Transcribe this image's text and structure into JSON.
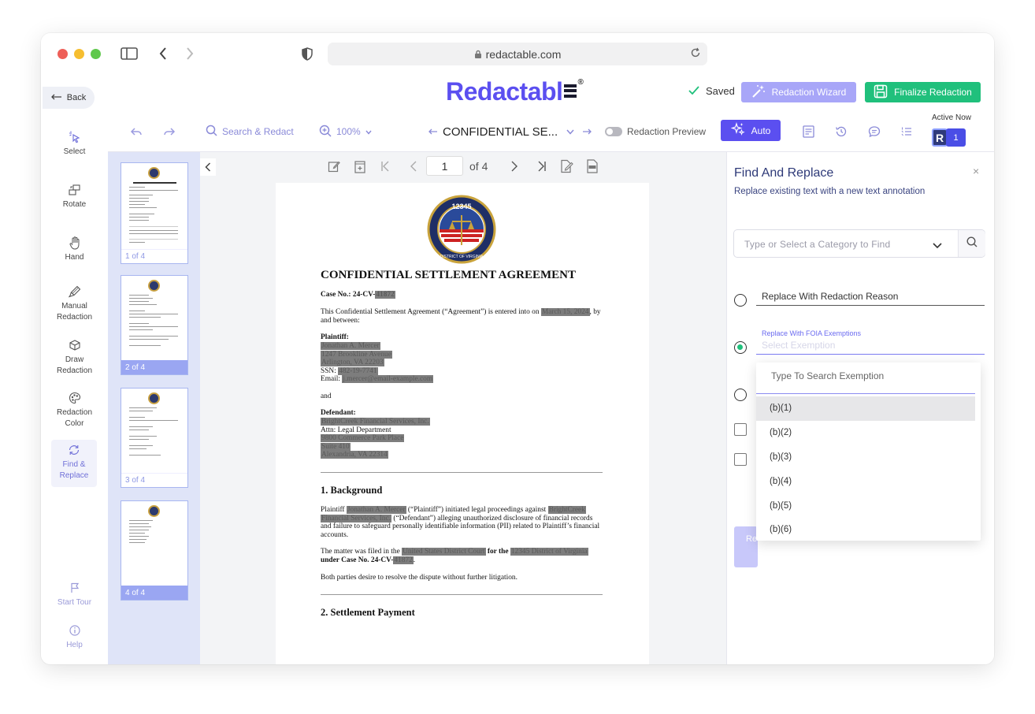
{
  "browser": {
    "url": "redactable.com"
  },
  "header": {
    "back_label": "Back",
    "logo_text": "Redactabl",
    "logo_reg": "®",
    "saved_label": "Saved",
    "wizard_label": "Redaction Wizard",
    "finalize_label": "Finalize Redaction"
  },
  "toolbar": {
    "search_label": "Search & Redact",
    "zoom_label": "100%",
    "doc_title": "CONFIDENTIAL SE...",
    "preview_label": "Redaction Preview",
    "auto_label": "Auto",
    "active_now_label": "Active Now",
    "avatar_initial": "R",
    "active_count": "1"
  },
  "sidebar": {
    "items": [
      {
        "label": "Select"
      },
      {
        "label": "Rotate"
      },
      {
        "label": "Hand"
      },
      {
        "label": "Manual Redaction"
      },
      {
        "label": "Draw Redaction"
      },
      {
        "label": "Redaction Color"
      },
      {
        "label": "Find & Replace"
      }
    ],
    "start_tour": "Start Tour",
    "help": "Help"
  },
  "thumbnails": [
    {
      "label": "1 of 4"
    },
    {
      "label": "2 of 4"
    },
    {
      "label": "3 of 4"
    },
    {
      "label": "4 of 4"
    }
  ],
  "viewer": {
    "current_page": "1",
    "of_pages": "of 4"
  },
  "document": {
    "title": "CONFIDENTIAL SETTLEMENT AGREEMENT",
    "case_label": "Case No.: 24-CV-",
    "case_red": "41872",
    "intro_a": "This Confidential Settlement Agreement (“Agreement”) is entered into on ",
    "intro_date": "March 15, 2024",
    "intro_b": ", by and between:",
    "plaintiff_label": "Plaintiff:",
    "plaintiff_name": "Jonathan A. Mercer",
    "plaintiff_addr1": "1247 Brookline Avenue",
    "plaintiff_addr2": "Arlington, VA 22203",
    "ssn_label": "SSN: ",
    "ssn": "482-19-7741",
    "email_label": "Email: ",
    "email": "j.mercer@email-example.com",
    "and_label": "and",
    "defendant_label": "Defendant:",
    "defendant_name": "BrightCreek Financial Services, Inc.",
    "attn": "Attn: Legal Department",
    "def_addr1": "9800 Commerce Park Place",
    "def_addr2": "Suite 410",
    "def_addr3": "Alexandria, VA 22314",
    "section1": "1. Background",
    "bg_a": "Plaintiff ",
    "bg_name": "Jonathan A. Mercer",
    "bg_b": " (“Plaintiff”) initiated legal proceedings against ",
    "bg_def1": "BrightCreek",
    "bg_def2": "Financial Services, Inc.",
    "bg_c": " (“Defendant”) alleging unauthorized disclosure of financial records and failure to safeguard personally identifiable information (PII) related to Plaintiff’s financial accounts.",
    "filed_a": "The matter was filed in the ",
    "filed_court": "United States District Court",
    "filed_b": " for the ",
    "filed_district": "12345 District of Virginia",
    "filed_c": " under Case No. 24-CV-",
    "filed_case": "41872",
    "filed_d": ".",
    "both": "Both parties desire to resolve the dispute without further litigation.",
    "section2": "2. Settlement Payment",
    "seal_number": "12345",
    "seal_text": "DISTRICT OF VIRGINIA"
  },
  "panel": {
    "title": "Find And Replace",
    "subtitle": "Replace existing text with a new text annotation",
    "category_placeholder": "Type or Select a Category to Find",
    "option_reason": "Replace With Redaction Reason",
    "option_foia": "Replace With FOIA Exemptions",
    "exemption_placeholder": "Select Exemption",
    "button_partial": "Re"
  },
  "dropdown": {
    "search_placeholder": "Type To Search Exemption",
    "options": [
      "(b)(1)",
      "(b)(2)",
      "(b)(3)",
      "(b)(4)",
      "(b)(5)",
      "(b)(6)"
    ]
  },
  "colors": {
    "accent": "#5b4ff0",
    "success": "#20c07c",
    "wizard": "#a8a6f8"
  }
}
